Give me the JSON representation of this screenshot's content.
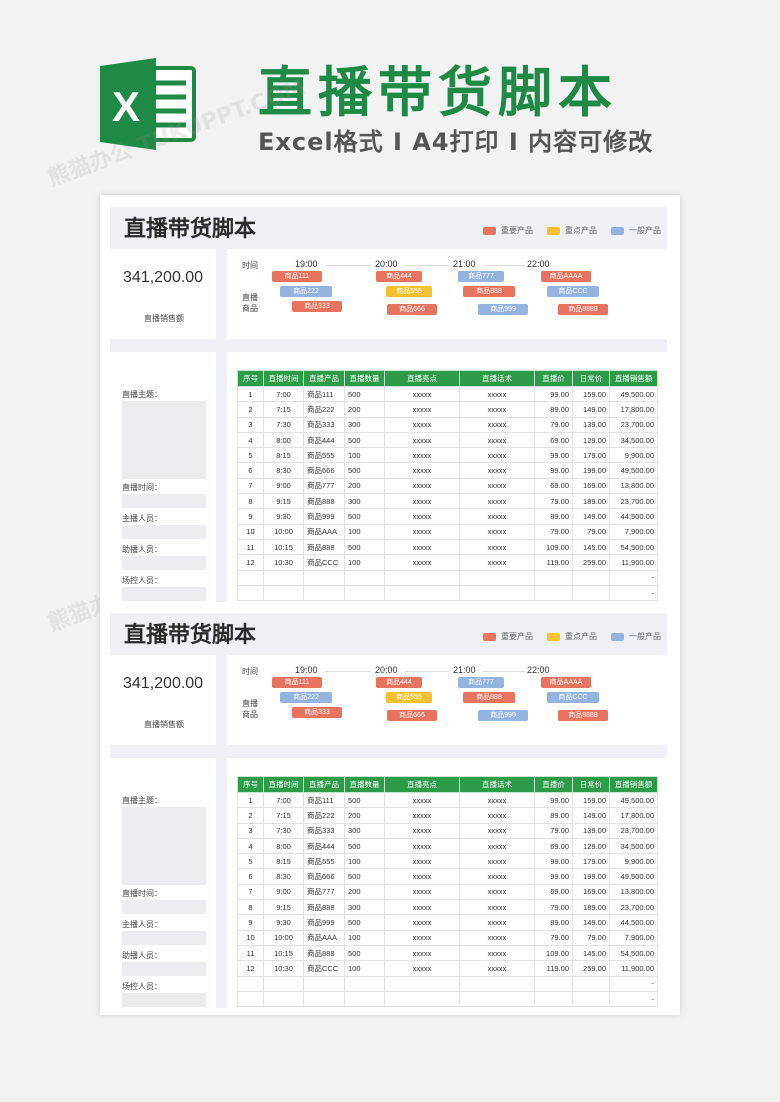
{
  "header": {
    "title": "直播带货脚本",
    "subtitle": "Excel格式 I A4打印 I 内容可修改",
    "logo_letter": "X",
    "brand_color": "#1e8a45"
  },
  "watermark": "熊猫办公 TUKUPPT.COM",
  "sheets": [
    {
      "title": "直播带货脚本",
      "legend": [
        {
          "label": "重要产品",
          "color": "#e8735e"
        },
        {
          "label": "重点产品",
          "color": "#f4c12f"
        },
        {
          "label": "一般产品",
          "color": "#94b3df"
        }
      ],
      "total_value": "341,200.00",
      "total_label": "直播销售额",
      "timeline": {
        "time_label": "时间",
        "product_label_1": "直播",
        "product_label_2": "商品",
        "times": [
          "19:00",
          "20:00",
          "21:00",
          "22:00"
        ]
      },
      "side_labels": [
        "直播主题：",
        "直播时间：",
        "主播人员：",
        "助播人员：",
        "场控人员："
      ],
      "table": {
        "headers": [
          "序号",
          "直播时间",
          "直播产品",
          "直播数量",
          "直播亮点",
          "直播话术",
          "直播价",
          "日常价",
          "直播销售额"
        ],
        "rows": [
          [
            "1",
            "7:00",
            "商品111",
            "500",
            "xxxxx",
            "xxxxx",
            "99.00",
            "159.00",
            "49,500.00"
          ],
          [
            "2",
            "7:15",
            "商品222",
            "200",
            "xxxxx",
            "xxxxx",
            "89.00",
            "149.00",
            "17,800.00"
          ],
          [
            "3",
            "7:30",
            "商品333",
            "300",
            "xxxxx",
            "xxxxx",
            "79.00",
            "139.00",
            "23,700.00"
          ],
          [
            "4",
            "8:00",
            "商品444",
            "500",
            "xxxxx",
            "xxxxx",
            "69.00",
            "129.00",
            "34,500.00"
          ],
          [
            "5",
            "8:15",
            "商品555",
            "100",
            "xxxxx",
            "xxxxx",
            "99.00",
            "179.00",
            "9,900.00"
          ],
          [
            "6",
            "8:30",
            "商品666",
            "500",
            "xxxxx",
            "xxxxx",
            "99.00",
            "199.00",
            "49,500.00"
          ],
          [
            "7",
            "9:00",
            "商品777",
            "200",
            "xxxxx",
            "xxxxx",
            "69.00",
            "169.00",
            "13,800.00"
          ],
          [
            "8",
            "9:15",
            "商品888",
            "300",
            "xxxxx",
            "xxxxx",
            "79.00",
            "189.00",
            "23,700.00"
          ],
          [
            "9",
            "9:30",
            "商品999",
            "500",
            "xxxxx",
            "xxxxx",
            "89.00",
            "149.00",
            "44,500.00"
          ],
          [
            "10",
            "10:00",
            "商品AAA",
            "100",
            "xxxxx",
            "xxxxx",
            "79.00",
            "79.00",
            "7,900.00"
          ],
          [
            "11",
            "10:15",
            "商品888",
            "500",
            "xxxxx",
            "xxxxx",
            "109.00",
            "145.00",
            "54,500.00"
          ],
          [
            "12",
            "10:30",
            "商品CCC",
            "100",
            "xxxxx",
            "xxxxx",
            "119.00",
            "259.00",
            "11,900.00"
          ],
          [
            "",
            "",
            "",
            "",
            "",
            "",
            "",
            "",
            "-"
          ],
          [
            "",
            "",
            "",
            "",
            "",
            "",
            "",
            "",
            "-"
          ]
        ]
      }
    },
    {
      "title": "直播带货脚本",
      "legend": [
        {
          "label": "重要产品",
          "color": "#e8735e"
        },
        {
          "label": "重点产品",
          "color": "#f4c12f"
        },
        {
          "label": "一般产品",
          "color": "#94b3df"
        }
      ],
      "total_value": "341,200.00",
      "total_label": "直播销售额",
      "timeline": {
        "time_label": "时间",
        "product_label_1": "直播",
        "product_label_2": "商品",
        "times": [
          "19:00",
          "20:00",
          "21:00",
          "22:00"
        ]
      },
      "side_labels": [
        "直播主题：",
        "直播时间：",
        "主播人员：",
        "助播人员：",
        "场控人员："
      ],
      "table": {
        "headers": [
          "序号",
          "直播时间",
          "直播产品",
          "直播数量",
          "直播亮点",
          "直播话术",
          "直播价",
          "日常价",
          "直播销售额"
        ],
        "rows": [
          [
            "1",
            "7:00",
            "商品111",
            "500",
            "xxxxx",
            "xxxxx",
            "99.00",
            "159.00",
            "49,500.00"
          ],
          [
            "2",
            "7:15",
            "商品222",
            "200",
            "xxxxx",
            "xxxxx",
            "89.00",
            "149.00",
            "17,800.00"
          ],
          [
            "3",
            "7:30",
            "商品333",
            "300",
            "xxxxx",
            "xxxxx",
            "79.00",
            "139.00",
            "23,700.00"
          ],
          [
            "4",
            "8:00",
            "商品444",
            "500",
            "xxxxx",
            "xxxxx",
            "69.00",
            "129.00",
            "34,500.00"
          ],
          [
            "5",
            "8:15",
            "商品555",
            "100",
            "xxxxx",
            "xxxxx",
            "99.00",
            "179.00",
            "9,900.00"
          ],
          [
            "6",
            "8:30",
            "商品666",
            "500",
            "xxxxx",
            "xxxxx",
            "99.00",
            "199.00",
            "49,500.00"
          ],
          [
            "7",
            "9:00",
            "商品777",
            "200",
            "xxxxx",
            "xxxxx",
            "69.00",
            "169.00",
            "13,800.00"
          ],
          [
            "8",
            "9:15",
            "商品888",
            "300",
            "xxxxx",
            "xxxxx",
            "79.00",
            "189.00",
            "23,700.00"
          ],
          [
            "9",
            "9:30",
            "商品999",
            "500",
            "xxxxx",
            "xxxxx",
            "89.00",
            "149.00",
            "44,500.00"
          ],
          [
            "10",
            "10:00",
            "商品AAA",
            "100",
            "xxxxx",
            "xxxxx",
            "79.00",
            "79.00",
            "7,900.00"
          ],
          [
            "11",
            "10:15",
            "商品888",
            "500",
            "xxxxx",
            "xxxxx",
            "109.00",
            "145.00",
            "54,500.00"
          ],
          [
            "12",
            "10:30",
            "商品CCC",
            "100",
            "xxxxx",
            "xxxxx",
            "119.00",
            "259.00",
            "11,900.00"
          ],
          [
            "",
            "",
            "",
            "",
            "",
            "",
            "",
            "",
            "-"
          ],
          [
            "",
            "",
            "",
            "",
            "",
            "",
            "",
            "",
            "-"
          ]
        ]
      }
    }
  ],
  "timeline_tags": [
    {
      "label": "商品111",
      "category": "red"
    },
    {
      "label": "商品222",
      "category": "blue"
    },
    {
      "label": "商品333",
      "category": "red"
    },
    {
      "label": "商品444",
      "category": "red"
    },
    {
      "label": "商品555",
      "category": "yellow"
    },
    {
      "label": "商品666",
      "category": "red"
    },
    {
      "label": "商品777",
      "category": "blue"
    },
    {
      "label": "商品888",
      "category": "red"
    },
    {
      "label": "商品999",
      "category": "blue"
    },
    {
      "label": "商品AAAA",
      "category": "red"
    },
    {
      "label": "商品CCC",
      "category": "blue"
    },
    {
      "label": "商品8888",
      "category": "red"
    }
  ]
}
